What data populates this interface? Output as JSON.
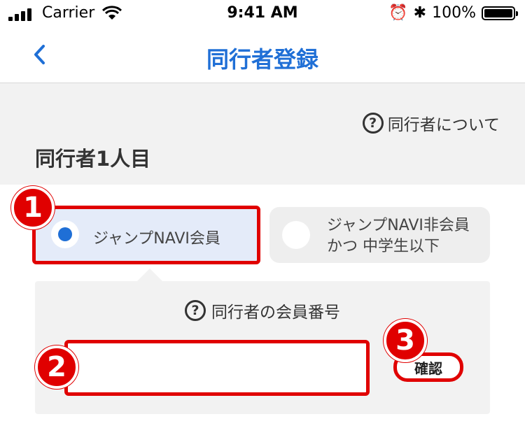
{
  "status_bar": {
    "carrier": "Carrier",
    "time": "9:41 AM",
    "battery": "100%"
  },
  "nav": {
    "title": "同行者登録",
    "back_icon": "chevron-left-icon"
  },
  "header": {
    "about_link": "同行者について",
    "companion_title": "同行者1人目"
  },
  "options": [
    {
      "label": "ジャンプNAVI会員",
      "selected": true
    },
    {
      "label_line1": "ジャンプNAVI非会員",
      "label_line2": "かつ 中学生以下",
      "selected": false
    }
  ],
  "member_panel": {
    "label": "同行者の会員番号",
    "input_value": "",
    "input_placeholder": "",
    "confirm_label": "確認"
  },
  "annotations": {
    "one": "1",
    "two": "2",
    "three": "3"
  },
  "colors": {
    "accent": "#1f6fd6",
    "highlight": "#e00000",
    "panel_bg": "#f2f2f2"
  }
}
